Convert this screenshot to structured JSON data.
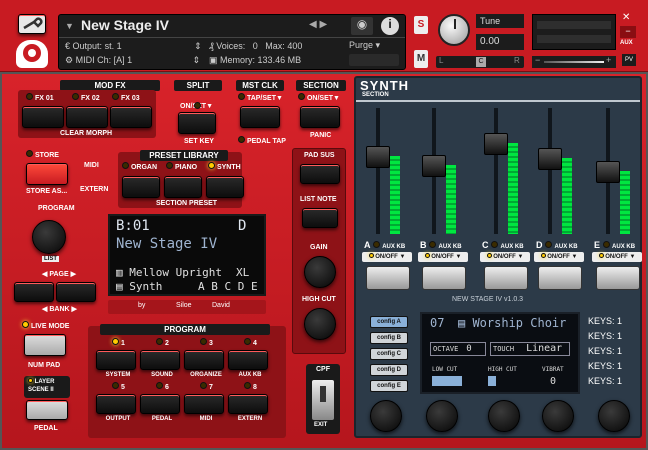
{
  "header": {
    "instrument_name": "New Stage IV",
    "output_label": "Output:",
    "output_value": "st. 1",
    "voices_label": "Voices:",
    "voices_value": "0",
    "max_label": "Max:",
    "max_value": "400",
    "purge_label": "Purge",
    "midi_label": "MIDI Ch:",
    "midi_value": "[A] 1",
    "memory_label": "Memory:",
    "memory_value": "133.46 MB",
    "s_label": "S",
    "m_label": "M",
    "tune_label": "Tune",
    "tune_value": "0.00",
    "pan_label": "L",
    "pan_center": "C",
    "pan_right": "R",
    "aux_label": "AUX",
    "pv_label": "PV"
  },
  "mod_fx": {
    "title": "MOD FX",
    "fx1": "FX 01",
    "fx2": "FX 02",
    "fx3": "FX 03",
    "clear": "CLEAR MORPH"
  },
  "split": {
    "title": "SPLIT",
    "onset": "ON/SET",
    "setkey": "SET KEY"
  },
  "mstclk": {
    "title": "MST CLK",
    "tapset": "TAP/SET",
    "pedaltap": "PEDAL TAP"
  },
  "section": {
    "title": "SECTION",
    "onset": "ON/SET",
    "panic": "PANIC"
  },
  "left": {
    "store": "STORE",
    "store_as": "STORE AS...",
    "midi": "MIDI",
    "extern": "EXTERN",
    "program": "PROGRAM",
    "list": "LIST",
    "page": "PAGE",
    "bank": "BANK",
    "live_mode": "LIVE MODE",
    "num_pad": "NUM PAD",
    "layer_scene": "LAYER SCENE II",
    "pedal": "PEDAL"
  },
  "preset_library": {
    "title": "PRESET LIBRARY",
    "organ": "ORGAN",
    "piano": "PIANO",
    "synth": "SYNTH",
    "section_preset": "SECTION PRESET"
  },
  "display": {
    "bank": "B:01",
    "slot": "D",
    "name": "New Stage IV",
    "line1": "Mellow Upright",
    "line1_tag": "XL",
    "line2": "Synth",
    "line2_tag": "A B C D E",
    "credit_by": "by",
    "credit_a": "Siloe",
    "credit_b": "David"
  },
  "program": {
    "title": "PROGRAM",
    "nums": [
      "1",
      "2",
      "3",
      "4",
      "5",
      "6",
      "7",
      "8"
    ],
    "labels_top": [
      "SYSTEM",
      "SOUND",
      "ORGANIZE",
      "AUX KB"
    ],
    "labels_bottom": [
      "OUTPUT",
      "PEDAL",
      "MIDI",
      "EXTERN"
    ]
  },
  "middle": {
    "pad_sus": "PAD SUS",
    "list_note": "LIST NOTE",
    "gain": "GAIN",
    "high_cut": "HIGH CUT",
    "cpf": "CPF",
    "exit": "EXIT"
  },
  "synth": {
    "title": "SYNTH",
    "subtitle": "SECTION",
    "channels": [
      "A",
      "B",
      "C",
      "D",
      "E"
    ],
    "aux": "AUX KB",
    "onoff": "ON/OFF",
    "version": "NEW STAGE IV v1.0.3",
    "configs": [
      "config A",
      "config B",
      "config C",
      "config D",
      "config E"
    ],
    "preset_num": "07",
    "preset_name": "Worship Choir",
    "octave_label": "OCTAVE",
    "octave_value": "0",
    "touch_label": "TOUCH",
    "touch_value": "Linear",
    "lowcut": "LOW CUT",
    "highcut": "HIGH CUT",
    "vibrat": "VIBRAT",
    "vibrat_value": "0",
    "keys": [
      "KEYS: 1",
      "KEYS: 1",
      "KEYS: 1",
      "KEYS: 1",
      "KEYS: 1"
    ],
    "fader_levels": [
      0.62,
      0.55,
      0.72,
      0.6,
      0.5
    ]
  }
}
